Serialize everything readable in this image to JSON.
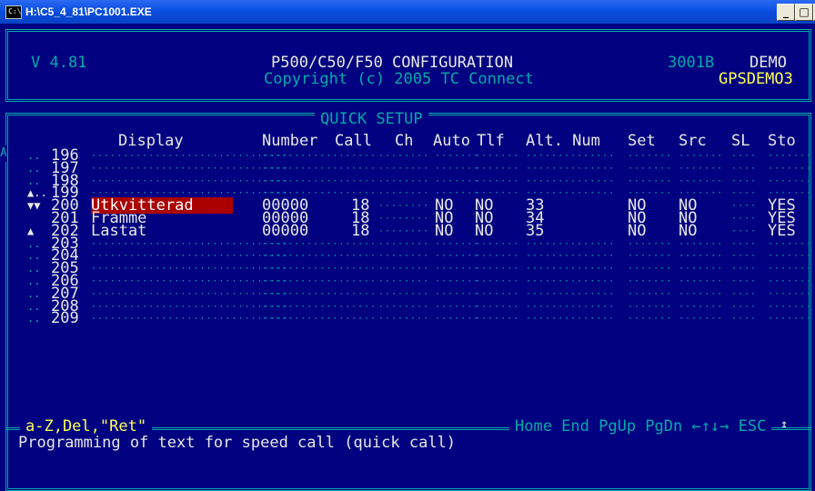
{
  "window": {
    "title": "H:\\C5_4_81\\PC1001.EXE",
    "icon_text": "C:\\"
  },
  "header": {
    "version": "V 4.81",
    "title": "P500/C50/F50 CONFIGURATION",
    "copyright": "Copyright (c) 2005 TC Connect",
    "code": "3001B",
    "mode": "DEMO",
    "user": "GPSDEMO3"
  },
  "section_title": "QUICK SETUP",
  "columns": [
    "Display",
    "Number",
    "Call",
    "Ch",
    "Auto",
    "Tlf",
    "Alt. Num",
    "Set",
    "Src",
    "SL",
    "Sto"
  ],
  "scroll_marker": "A",
  "rows": [
    {
      "mark": "..",
      "num": "196",
      "display": "",
      "number": "",
      "call": "",
      "auto": "",
      "tlf": "",
      "alt": "",
      "set": "",
      "src": "",
      "sto": ""
    },
    {
      "mark": "..",
      "num": "197",
      "display": "",
      "number": "",
      "call": "",
      "auto": "",
      "tlf": "",
      "alt": "",
      "set": "",
      "src": "",
      "sto": ""
    },
    {
      "mark": "..",
      "num": "198",
      "display": "",
      "number": "",
      "call": "",
      "auto": "",
      "tlf": "",
      "alt": "",
      "set": "",
      "src": "",
      "sto": ""
    },
    {
      "mark": "▲..",
      "num": "199",
      "display": "",
      "number": "",
      "call": "",
      "auto": "",
      "tlf": "",
      "alt": "",
      "set": "",
      "src": "",
      "sto": ""
    },
    {
      "mark": "▼▼",
      "num": "200",
      "display": "Utkvitterad",
      "number": "00000",
      "call": "18",
      "auto": "NO",
      "tlf": "NO",
      "alt": "33",
      "set": "NO",
      "src": "NO",
      "sto": "YES"
    },
    {
      "mark": "",
      "num": "201",
      "display": "Framme",
      "number": "00000",
      "call": "18",
      "auto": "NO",
      "tlf": "NO",
      "alt": "34",
      "set": "NO",
      "src": "NO",
      "sto": "YES"
    },
    {
      "mark": "▲",
      "num": "202",
      "display": "Lastat",
      "number": "00000",
      "call": "18",
      "auto": "NO",
      "tlf": "NO",
      "alt": "35",
      "set": "NO",
      "src": "NO",
      "sto": "YES"
    },
    {
      "mark": "..",
      "num": "203",
      "display": "",
      "number": "",
      "call": "",
      "auto": "",
      "tlf": "",
      "alt": "",
      "set": "",
      "src": "",
      "sto": ""
    },
    {
      "mark": "..",
      "num": "204",
      "display": "",
      "number": "",
      "call": "",
      "auto": "",
      "tlf": "",
      "alt": "",
      "set": "",
      "src": "",
      "sto": ""
    },
    {
      "mark": "..",
      "num": "205",
      "display": "",
      "number": "",
      "call": "",
      "auto": "",
      "tlf": "",
      "alt": "",
      "set": "",
      "src": "",
      "sto": ""
    },
    {
      "mark": "..",
      "num": "206",
      "display": "",
      "number": "",
      "call": "",
      "auto": "",
      "tlf": "",
      "alt": "",
      "set": "",
      "src": "",
      "sto": ""
    },
    {
      "mark": "..",
      "num": "207",
      "display": "",
      "number": "",
      "call": "",
      "auto": "",
      "tlf": "",
      "alt": "",
      "set": "",
      "src": "",
      "sto": ""
    },
    {
      "mark": "..",
      "num": "208",
      "display": "",
      "number": "",
      "call": "",
      "auto": "",
      "tlf": "",
      "alt": "",
      "set": "",
      "src": "",
      "sto": ""
    },
    {
      "mark": "..",
      "num": "209",
      "display": "",
      "number": "",
      "call": "",
      "auto": "",
      "tlf": "",
      "alt": "",
      "set": "",
      "src": "",
      "sto": ""
    }
  ],
  "footer": {
    "keys_left": "a-Z,Del,\"Ret\"",
    "keys_right": "Home End PgUp PgDn ←↑↓→ ESC",
    "status": "Programming of text for speed call (quick call)",
    "scroll_arrow": "↕"
  },
  "colors": {
    "background": "#000080",
    "frame": "#00aaaa",
    "highlight": "#aa0000",
    "accent": "#ffff55"
  }
}
